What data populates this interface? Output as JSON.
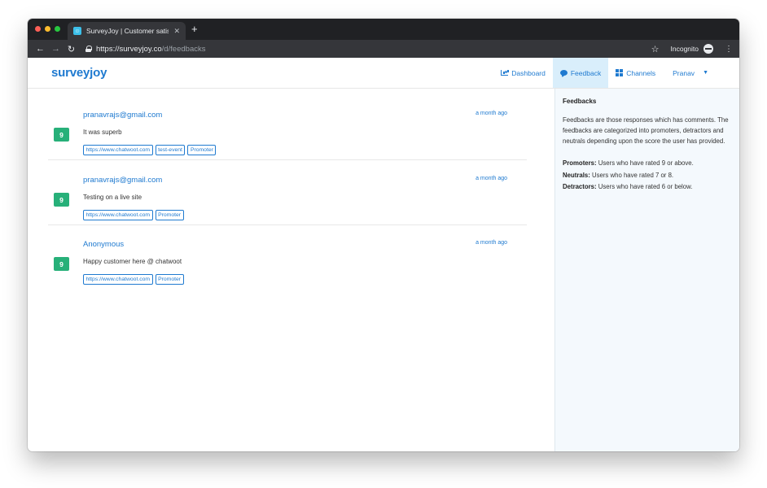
{
  "browser": {
    "tab_title": "SurveyJoy | Customer satisfact",
    "tab_close": "✕",
    "new_tab": "+",
    "url_host": "https://surveyjoy.co",
    "url_path": "/d/feedbacks",
    "incognito_label": "Incognito"
  },
  "app": {
    "logo": "surveyjoy",
    "nav": {
      "dashboard": "Dashboard",
      "feedback": "Feedback",
      "channels": "Channels",
      "user": "Pranav"
    }
  },
  "feedbacks": [
    {
      "score": "9",
      "email": "pranavrajs@gmail.com",
      "time": "a month ago",
      "text": "It was superb",
      "tags": [
        "https://www.chatwoot.com",
        "test-event",
        "Promoter"
      ]
    },
    {
      "score": "9",
      "email": "pranavrajs@gmail.com",
      "time": "a month ago",
      "text": "Testing on a live site",
      "tags": [
        "https://www.chatwoot.com",
        "Promoter"
      ]
    },
    {
      "score": "9",
      "email": "Anonymous",
      "time": "a month ago",
      "text": "Happy customer here @ chatwoot",
      "tags": [
        "https://www.chatwoot.com",
        "Promoter"
      ]
    }
  ],
  "sidebar": {
    "title": "Feedbacks",
    "description": "Feedbacks are those responses which has comments. The feedbacks are categorized into promoters, detractors and neutrals depending upon the score the user has provided.",
    "definitions": [
      {
        "term": "Promoters:",
        "text": " Users who have rated 9 or above."
      },
      {
        "term": "Neutrals:",
        "text": " Users who have rated 7 or 8."
      },
      {
        "term": "Detractors:",
        "text": " Users who have rated 6 or below."
      }
    ]
  },
  "colors": {
    "brand": "#1f7ad0",
    "score_green": "#27b079",
    "active_nav_bg": "#d9eefb",
    "sidebar_bg": "#f4f9fd"
  }
}
